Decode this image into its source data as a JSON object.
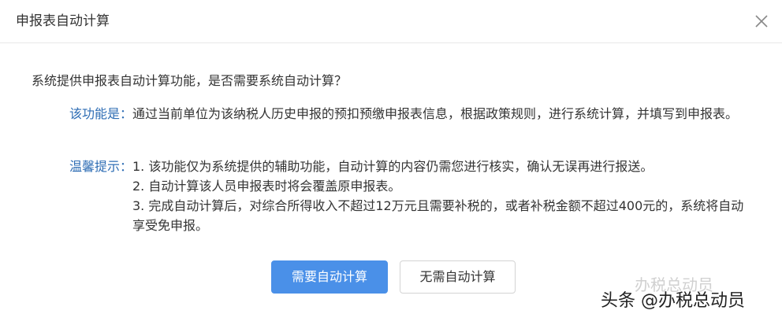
{
  "dialog": {
    "title": "申报表自动计算",
    "question": "系统提供申报表自动计算功能，是否需要系统自动计算？",
    "feature_label": "该功能是：",
    "feature_text": "通过当前单位为该纳税人历史申报的预扣预缴申报表信息，根据政策规则，进行系统计算，并填写到申报表。",
    "tips_label": "温馨提示：",
    "tips": [
      "1. 该功能仅为系统提供的辅助功能，自动计算的内容仍需您进行核实，确认无误再进行报送。",
      "2. 自动计算该人员申报表时将会覆盖原申报表。",
      "3. 完成自动计算后，对综合所得收入不超过12万元且需要补税的，或者补税金额不超过400元的，系统将自动享受免申报。"
    ],
    "primary_button": "需要自动计算",
    "secondary_button": "无需自动计算",
    "close_icon": "close-icon"
  },
  "watermark": {
    "faint": "办税总动员",
    "text": "头条 @办税总动员"
  },
  "colors": {
    "primary": "#4a90e8",
    "label_blue": "#2e6db4",
    "border": "#d4d4d4"
  }
}
